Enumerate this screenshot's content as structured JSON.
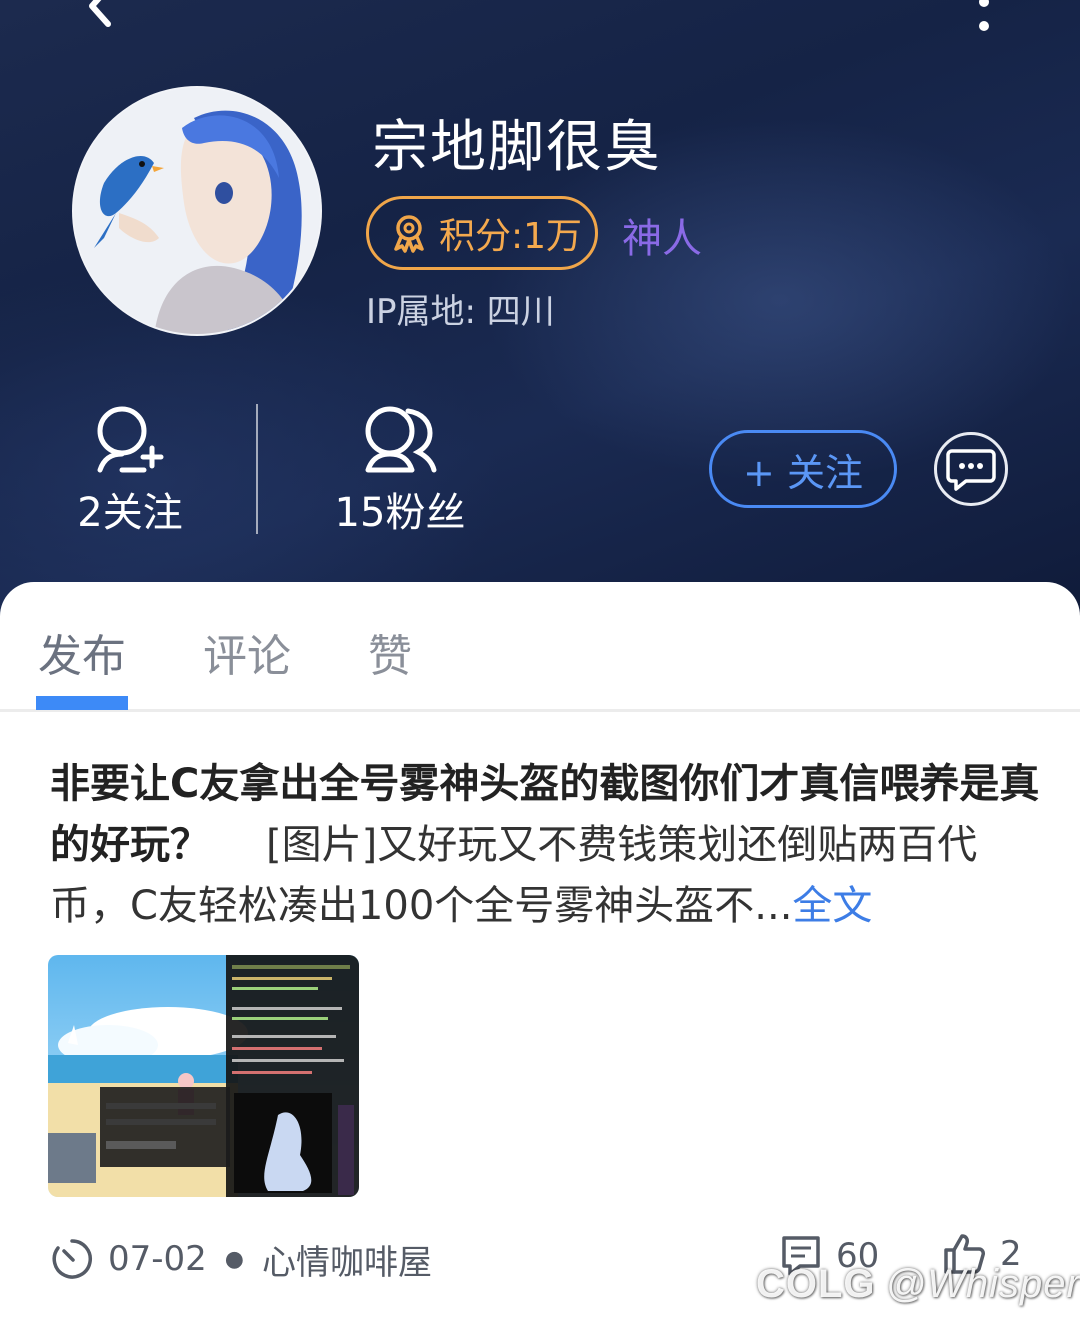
{
  "profile": {
    "username": "宗地脚很臭",
    "score_label": "积分:1万",
    "title_badge": "神人",
    "ip_location": "IP属地: 四川",
    "following_label": "2关注",
    "fans_label": "15粉丝",
    "follow_button": "+ 关注"
  },
  "tabs": [
    "发布",
    "评论",
    "赞"
  ],
  "active_tab": "发布",
  "post": {
    "title": "非要让C友拿出全号雾神头盔的截图你们才真信喂养是真的好玩？",
    "body": "[图片]又好玩又不费钱策划还倒贴两百代币，C友轻松凑出100个全号雾神头盔不...",
    "more_link": "全文",
    "date": "07-02",
    "category": "心情咖啡屋",
    "comment_count": "60",
    "like_count": "2"
  },
  "watermark": {
    "brand": "COLG",
    "handle": "@Whisper"
  },
  "colors": {
    "accent_blue": "#3d8af7",
    "score_orange": "#f4a94e",
    "title_purple": "#8a6ae6",
    "header_bg": "#1a2a52"
  },
  "icons": [
    "back-icon",
    "more-icon",
    "medal-icon",
    "follow-user-icon",
    "fans-icon",
    "message-icon",
    "clock-icon",
    "comment-icon",
    "like-icon"
  ]
}
